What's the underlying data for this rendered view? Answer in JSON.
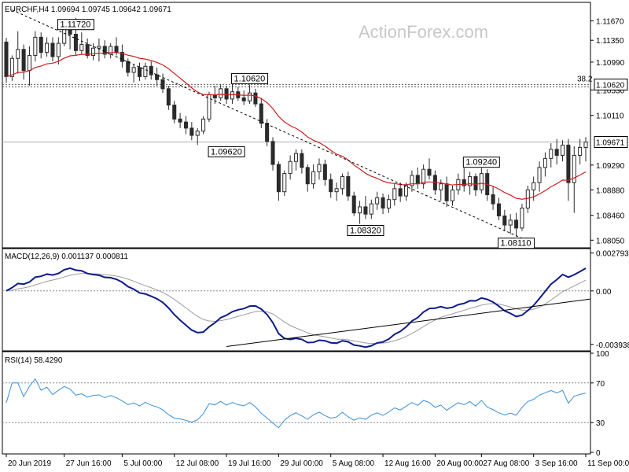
{
  "watermark": "ActionForex.com",
  "chart_data": {
    "type": "line",
    "main": {
      "header": "EURCHF,H4  1.09694 1.09745 1.09642 1.09671",
      "ylim": [
        1.0795,
        1.1195
      ],
      "y_ticks": [
        "1.11670",
        "1.11350",
        "1.10990",
        "1.10530",
        "1.10110",
        "1.09290",
        "1.08880",
        "1.08460",
        "1.08050"
      ],
      "y_tick_values": [
        1.1167,
        1.1135,
        1.1099,
        1.1053,
        1.1011,
        1.0929,
        1.0888,
        1.0846,
        1.0805
      ],
      "last_price": "1.09671",
      "last_value": 1.09671,
      "fib_value": 1.1062,
      "fib_tag": "38.2",
      "fib_price": "1.10620",
      "annotations": [
        {
          "text": "1.11720",
          "idx": 12,
          "value": 1.1172,
          "place": "below"
        },
        {
          "text": "1.10620",
          "idx": 42,
          "value": 1.1062,
          "place": "above"
        },
        {
          "text": "1.09620",
          "idx": 38,
          "value": 1.0962,
          "place": "below"
        },
        {
          "text": "1.08320",
          "idx": 62,
          "value": 1.0832,
          "place": "below"
        },
        {
          "text": "1.09240",
          "idx": 82,
          "value": 1.0924,
          "place": "above"
        },
        {
          "text": "1.08110",
          "idx": 88,
          "value": 1.0811,
          "place": "below"
        }
      ],
      "bars": [
        [
          1.1132,
          1.1139,
          1.1065,
          1.1075
        ],
        [
          1.1075,
          1.111,
          1.1068,
          1.1105
        ],
        [
          1.1105,
          1.115,
          1.108,
          1.112
        ],
        [
          1.112,
          1.1128,
          1.107,
          1.1085
        ],
        [
          1.1085,
          1.1125,
          1.106,
          1.111
        ],
        [
          1.111,
          1.115,
          1.11,
          1.114
        ],
        [
          1.114,
          1.1148,
          1.1105,
          1.1115
        ],
        [
          1.1115,
          1.114,
          1.1108,
          1.113
        ],
        [
          1.113,
          1.114,
          1.11,
          1.1108
        ],
        [
          1.1108,
          1.114,
          1.1095,
          1.113
        ],
        [
          1.113,
          1.1165,
          1.1125,
          1.1155
        ],
        [
          1.1155,
          1.1165,
          1.112,
          1.1145
        ],
        [
          1.1145,
          1.1172,
          1.111,
          1.1118
        ],
        [
          1.1118,
          1.1148,
          1.1112,
          1.1128
        ],
        [
          1.1128,
          1.1138,
          1.1105,
          1.111
        ],
        [
          1.111,
          1.113,
          1.1102,
          1.1122
        ],
        [
          1.1122,
          1.1138,
          1.11,
          1.1125
        ],
        [
          1.1125,
          1.1135,
          1.1105,
          1.1112
        ],
        [
          1.1112,
          1.113,
          1.1105,
          1.1125
        ],
        [
          1.1125,
          1.114,
          1.111,
          1.1115
        ],
        [
          1.1115,
          1.1128,
          1.109,
          1.11
        ],
        [
          1.11,
          1.1105,
          1.1075,
          1.1082
        ],
        [
          1.1082,
          1.1095,
          1.1065,
          1.109
        ],
        [
          1.109,
          1.1098,
          1.1068,
          1.1075
        ],
        [
          1.1075,
          1.1098,
          1.107,
          1.1092
        ],
        [
          1.1092,
          1.11,
          1.107,
          1.1078
        ],
        [
          1.1078,
          1.109,
          1.106,
          1.107
        ],
        [
          1.107,
          1.108,
          1.1048,
          1.1055
        ],
        [
          1.1055,
          1.106,
          1.102,
          1.1028
        ],
        [
          1.1028,
          1.1035,
          1.0998,
          1.1005
        ],
        [
          1.1005,
          1.1015,
          1.099,
          1.1
        ],
        [
          1.1,
          1.101,
          1.098,
          1.099
        ],
        [
          1.099,
          1.1,
          1.097,
          1.0978
        ],
        [
          1.0978,
          1.099,
          1.0962,
          1.0985
        ],
        [
          1.0985,
          1.101,
          1.098,
          1.1005
        ],
        [
          1.1005,
          1.105,
          1.1,
          1.1045
        ],
        [
          1.1045,
          1.106,
          1.103,
          1.104
        ],
        [
          1.104,
          1.1062,
          1.1035,
          1.1055
        ],
        [
          1.1055,
          1.106,
          1.103,
          1.1038
        ],
        [
          1.1038,
          1.1062,
          1.103,
          1.105
        ],
        [
          1.105,
          1.1058,
          1.1035,
          1.104
        ],
        [
          1.104,
          1.1052,
          1.1028,
          1.1035
        ],
        [
          1.1035,
          1.1062,
          1.103,
          1.1048
        ],
        [
          1.1048,
          1.1055,
          1.1025,
          1.103
        ],
        [
          1.103,
          1.104,
          1.099,
          1.0998
        ],
        [
          1.0998,
          1.1005,
          1.096,
          1.0968
        ],
        [
          1.0968,
          1.0975,
          1.092,
          1.093
        ],
        [
          1.093,
          1.0935,
          1.087,
          1.0885
        ],
        [
          1.0885,
          1.092,
          1.0878,
          1.0915
        ],
        [
          1.0915,
          1.0945,
          1.0905,
          1.0935
        ],
        [
          1.0935,
          1.0955,
          1.092,
          1.0948
        ],
        [
          1.0948,
          1.0955,
          1.0915,
          1.0925
        ],
        [
          1.0925,
          1.093,
          1.0885,
          1.0898
        ],
        [
          1.0898,
          1.093,
          1.089,
          1.0918
        ],
        [
          1.0918,
          1.094,
          1.0905,
          1.093
        ],
        [
          1.093,
          1.0938,
          1.0895,
          1.0905
        ],
        [
          1.0905,
          1.0915,
          1.0875,
          1.0885
        ],
        [
          1.0885,
          1.09,
          1.087,
          1.089
        ],
        [
          1.089,
          1.0915,
          1.088,
          1.091
        ],
        [
          1.091,
          1.0918,
          1.087,
          1.0878
        ],
        [
          1.0878,
          1.0885,
          1.0845,
          1.085
        ],
        [
          1.085,
          1.087,
          1.0832,
          1.086
        ],
        [
          1.086,
          1.0878,
          1.084,
          1.0848
        ],
        [
          1.0848,
          1.0872,
          1.084,
          1.0865
        ],
        [
          1.0865,
          1.0885,
          1.0855,
          1.0875
        ],
        [
          1.0875,
          1.0882,
          1.0848,
          1.0858
        ],
        [
          1.0858,
          1.088,
          1.085,
          1.0872
        ],
        [
          1.0872,
          1.0898,
          1.0862,
          1.089
        ],
        [
          1.089,
          1.09,
          1.0868,
          1.0878
        ],
        [
          1.0878,
          1.09,
          1.087,
          1.0895
        ],
        [
          1.0895,
          1.092,
          1.0885,
          1.0912
        ],
        [
          1.0912,
          1.0925,
          1.089,
          1.0898
        ],
        [
          1.0898,
          1.093,
          1.089,
          1.0922
        ],
        [
          1.0922,
          1.094,
          1.0905,
          1.0912
        ],
        [
          1.0912,
          1.092,
          1.088,
          1.0888
        ],
        [
          1.0888,
          1.0905,
          1.087,
          1.0898
        ],
        [
          1.0898,
          1.091,
          1.086,
          1.087
        ],
        [
          1.087,
          1.0895,
          1.0862,
          1.0888
        ],
        [
          1.0888,
          1.0915,
          1.088,
          1.0905
        ],
        [
          1.0905,
          1.0924,
          1.0885,
          1.0895
        ],
        [
          1.0895,
          1.0918,
          1.088,
          1.091
        ],
        [
          1.091,
          1.0915,
          1.0878,
          1.0888
        ],
        [
          1.0888,
          1.0924,
          1.0882,
          1.0915
        ],
        [
          1.0915,
          1.0922,
          1.087,
          1.088
        ],
        [
          1.088,
          1.0895,
          1.0855,
          1.0865
        ],
        [
          1.0865,
          1.0875,
          1.0838,
          1.0845
        ],
        [
          1.0845,
          1.0855,
          1.082,
          1.083
        ],
        [
          1.083,
          1.0848,
          1.0815,
          1.0838
        ],
        [
          1.0838,
          1.085,
          1.0811,
          1.0825
        ],
        [
          1.0825,
          1.0865,
          1.082,
          1.0858
        ],
        [
          1.0858,
          1.0895,
          1.085,
          1.0888
        ],
        [
          1.0888,
          1.091,
          1.087,
          1.09
        ],
        [
          1.09,
          1.0935,
          1.0885,
          1.0925
        ],
        [
          1.0925,
          1.095,
          1.091,
          1.094
        ],
        [
          1.094,
          1.0965,
          1.0925,
          1.0955
        ],
        [
          1.0955,
          1.0972,
          1.093,
          1.0945
        ],
        [
          1.0945,
          1.097,
          1.0935,
          1.0962
        ],
        [
          1.0962,
          1.0972,
          1.087,
          1.09
        ],
        [
          1.09,
          1.096,
          1.085,
          1.0945
        ],
        [
          1.0945,
          1.0972,
          1.093,
          1.0958
        ],
        [
          1.0958,
          1.0975,
          1.0935,
          1.0967
        ]
      ],
      "ema_period": 20,
      "trendline": [
        [
          1,
          1.1185
        ],
        [
          89,
          1.0808
        ]
      ]
    },
    "macd": {
      "header": "MACD(12,26,9) 0.001137 0.000811",
      "ylim": [
        -0.0043,
        0.003
      ],
      "y_ticks": [
        "0.002793",
        "0.00",
        "-0.003938"
      ],
      "y_tick_values": [
        0.002793,
        0.0,
        -0.003938
      ],
      "trendline": [
        [
          85,
          -0.0023
        ],
        [
          99,
          -0.0015
        ]
      ]
    },
    "rsi": {
      "header": "RSI(14) 58.4290",
      "ylim": [
        0,
        100
      ],
      "y_ticks": [
        "100",
        "70",
        "30",
        "0"
      ],
      "y_tick_values": [
        100,
        70,
        30,
        0
      ],
      "levels": [
        70,
        30
      ]
    },
    "x_ticks": [
      {
        "label": "20 Jun 2019",
        "idx": 0
      },
      {
        "label": "27 Jun 16:00",
        "idx": 10
      },
      {
        "label": "5 Jul 00:00",
        "idx": 20
      },
      {
        "label": "12 Jul 08:00",
        "idx": 29
      },
      {
        "label": "19 Jul 16:00",
        "idx": 38
      },
      {
        "label": "29 Jul 00:00",
        "idx": 47
      },
      {
        "label": "5 Aug 08:00",
        "idx": 56
      },
      {
        "label": "12 Aug 16:00",
        "idx": 65
      },
      {
        "label": "20 Aug 00:00",
        "idx": 74
      },
      {
        "label": "27 Aug 08:00",
        "idx": 82
      },
      {
        "label": "3 Sep 16:00",
        "idx": 91
      },
      {
        "label": "11 Sep 00:00",
        "idx": 100
      }
    ],
    "colors": {
      "up": "#2b2b2b",
      "down": "#2b2b2b",
      "ema": "#cc1f1f",
      "macd": "#0d1b8c",
      "signal": "#9c9c9c",
      "rsi": "#3b8fd9"
    }
  }
}
